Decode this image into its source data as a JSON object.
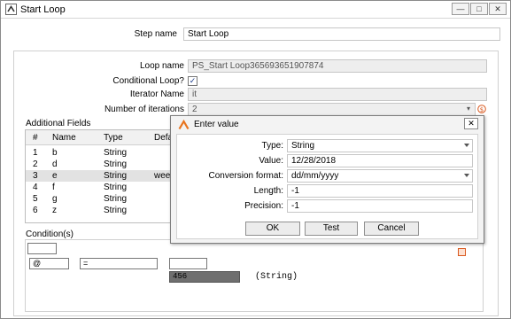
{
  "window": {
    "title": "Start Loop",
    "buttons": [
      "—",
      "□",
      "✕"
    ]
  },
  "form": {
    "step_name_label": "Step name",
    "step_name_value": "Start Loop",
    "loop_name_label": "Loop name",
    "loop_name_value": "PS_Start Loop365693651907874",
    "conditional_loop_label": "Conditional Loop?",
    "conditional_loop_check": "✓",
    "iterator_name_label": "Iterator Name",
    "iterator_name_value": "it",
    "iterations_label": "Number of iterations",
    "iterations_value": "2"
  },
  "additional_fields": {
    "title": "Additional Fields",
    "columns": [
      "#",
      "Name",
      "Type",
      "Defa"
    ],
    "rows": [
      {
        "num": "1",
        "name": "b",
        "type": "String",
        "def": ""
      },
      {
        "num": "2",
        "name": "d",
        "type": "String",
        "def": ""
      },
      {
        "num": "3",
        "name": "e",
        "type": "String",
        "def": "wee"
      },
      {
        "num": "4",
        "name": "f",
        "type": "String",
        "def": ""
      },
      {
        "num": "5",
        "name": "g",
        "type": "String",
        "def": ""
      },
      {
        "num": "6",
        "name": "z",
        "type": "String",
        "def": ""
      }
    ]
  },
  "conditions": {
    "title": "Condition(s)",
    "field_value": "@",
    "operator_value": "=",
    "value_box": "456",
    "value_type": "(String)"
  },
  "dialog": {
    "title": "Enter value",
    "type_label": "Type:",
    "type_value": "String",
    "value_label": "Value:",
    "value_value": "12/28/2018",
    "conversion_label": "Conversion format:",
    "conversion_value": "dd/mm/yyyy",
    "length_label": "Length:",
    "length_value": "-1",
    "precision_label": "Precision:",
    "precision_value": "-1",
    "ok_label": "OK",
    "test_label": "Test",
    "cancel_label": "Cancel"
  },
  "colors": {
    "accent_logo": "#e8741e",
    "selected_row": "#e2e2e2",
    "value_box_bg": "#6f6f6f"
  }
}
